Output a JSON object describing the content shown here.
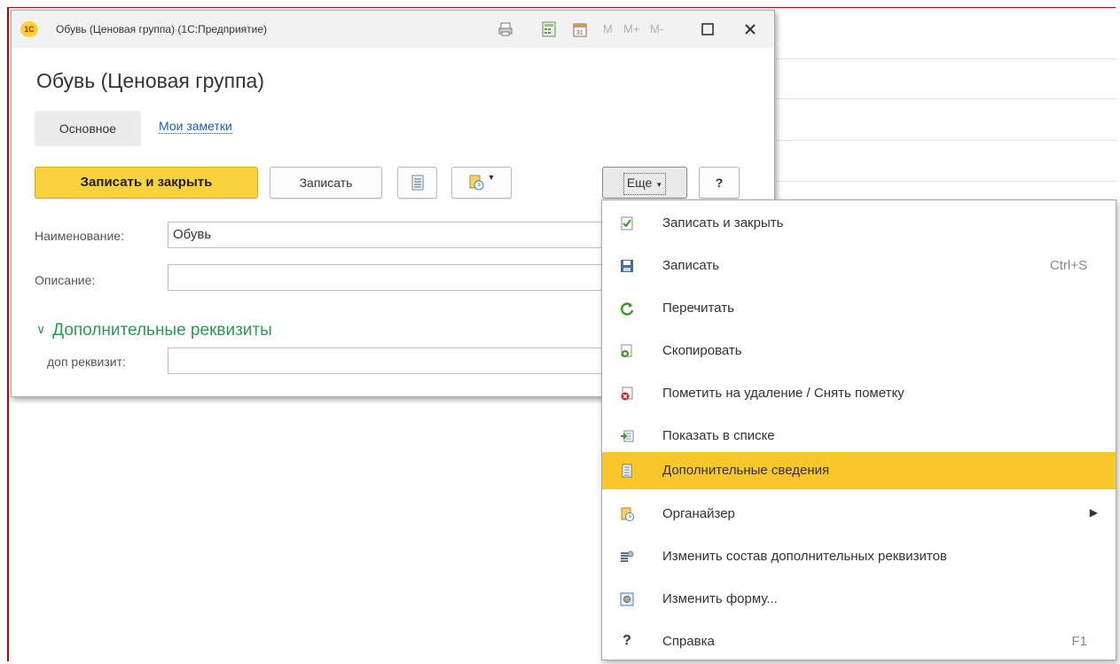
{
  "window": {
    "title": "Обувь (Ценовая группа)  (1С:Предприятие)",
    "logo": "1С",
    "memory_buttons": [
      "M",
      "M+",
      "M-"
    ]
  },
  "form": {
    "title": "Обувь (Ценовая группа)",
    "tabs": [
      {
        "label": "Основное",
        "active": true
      },
      {
        "label": "Мои заметки",
        "active": false
      }
    ],
    "toolbar": {
      "save_close": "Записать и закрыть",
      "save": "Записать",
      "more": "Еще",
      "help": "?"
    },
    "fields": {
      "name_label": "Наименование:",
      "name_value": "Обувь",
      "description_label": "Описание:",
      "description_value": "",
      "group_title": "Дополнительные реквизиты",
      "extra_label": "доп реквизит:",
      "extra_value": ""
    }
  },
  "menu": {
    "items": [
      {
        "label": "Записать и закрыть",
        "icon": "check-document-icon"
      },
      {
        "label": "Записать",
        "shortcut": "Ctrl+S",
        "icon": "floppy-disk-icon"
      },
      {
        "label": "Перечитать",
        "icon": "refresh-icon"
      },
      {
        "label": "Скопировать",
        "icon": "copy-document-icon"
      },
      {
        "label": "Пометить на удаление / Снять пометку",
        "icon": "delete-mark-icon"
      },
      {
        "label": "Показать в списке",
        "icon": "show-in-list-icon"
      },
      {
        "label": "Дополнительные сведения",
        "icon": "details-icon",
        "highlighted": true
      },
      {
        "label": "Органайзер",
        "icon": "organizer-icon",
        "submenu": true
      },
      {
        "label": "Изменить состав дополнительных реквизитов",
        "icon": "edit-attributes-icon"
      },
      {
        "label": "Изменить форму...",
        "icon": "change-form-icon"
      },
      {
        "label": "Справка",
        "shortcut": "F1",
        "icon": "help-icon"
      }
    ]
  },
  "colors": {
    "accent_yellow": "#fad23d",
    "link_blue": "#1c5fb5",
    "group_green": "#2a9a55",
    "frame_red": "#c00000"
  }
}
